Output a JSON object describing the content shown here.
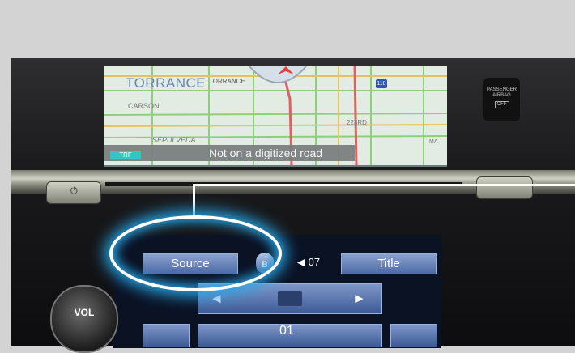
{
  "map": {
    "city_label": "TORRANCE",
    "city_label_small": "TORRANCE",
    "area_label": "CARSON",
    "street_label": "SEPULVEDA",
    "street_label_2": "223RD",
    "street_label_3": "MA",
    "highway_shield": "110",
    "status_text": "Not on a digitized road",
    "traffic_badge": "TRF"
  },
  "airbag_indicator": {
    "line1": "PASSENGER",
    "line2": "AIRBAG",
    "state": "OFF"
  },
  "audio_screen": {
    "source_button": "Source",
    "title_button": "Title",
    "volume_level": "07",
    "track_number": "01",
    "folder_next_glyph": "►",
    "folder_prev_glyph": "◄",
    "bluetooth_icon": "bluetooth-icon"
  },
  "controls": {
    "vol_knob_label": "VOL",
    "power_icon": "power-icon"
  },
  "colors": {
    "highlight": "#27a6e6",
    "button_blue": "#4d6aa6",
    "traffic_badge": "#37c4c8"
  }
}
